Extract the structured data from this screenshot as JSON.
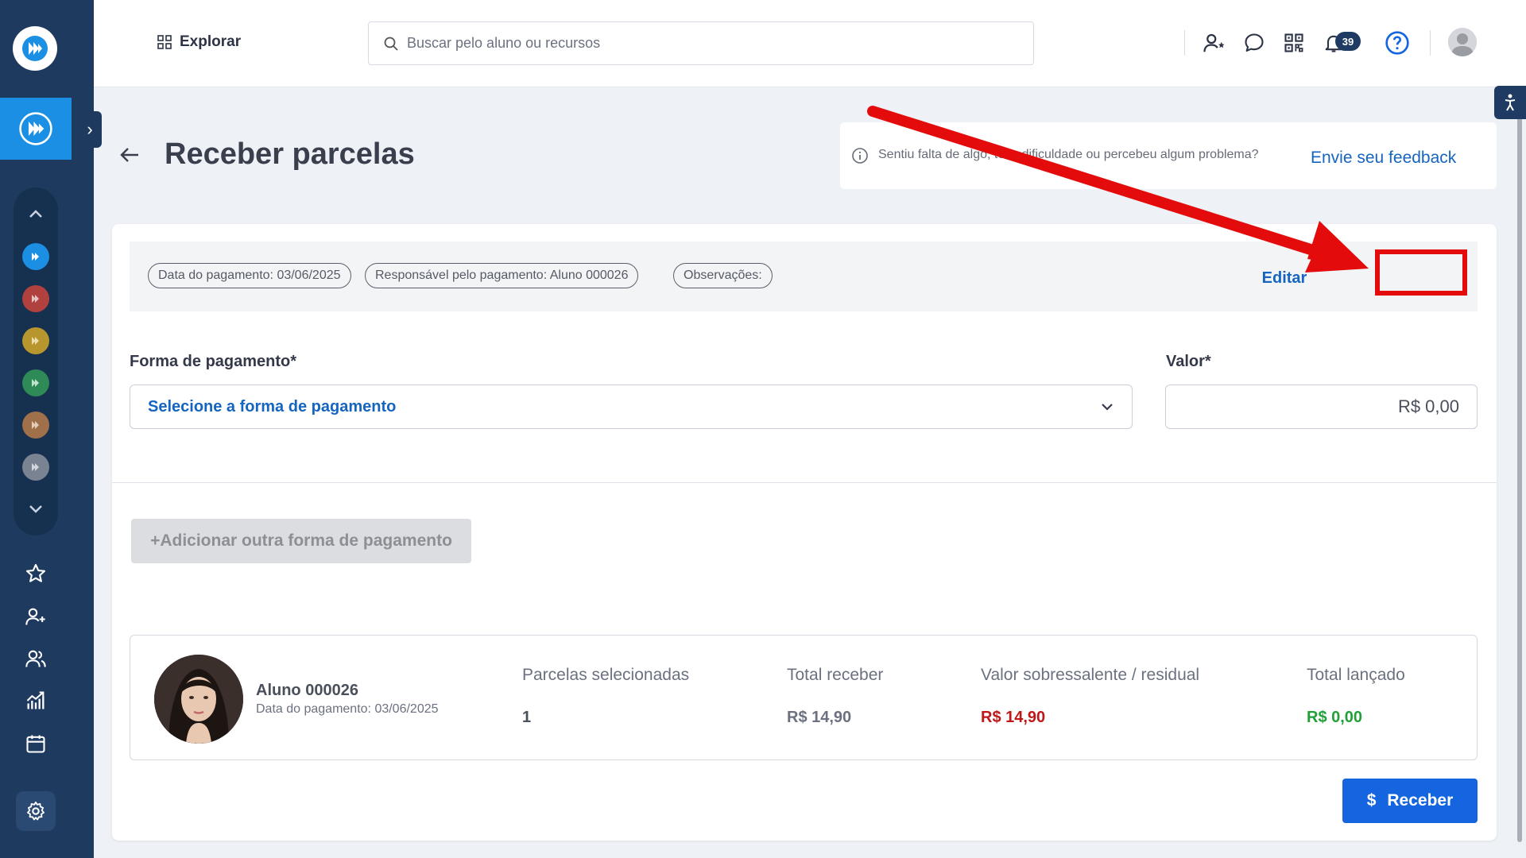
{
  "header": {
    "explore_label": "Explorar",
    "search_placeholder": "Buscar pelo aluno ou recursos",
    "notification_count": "39"
  },
  "page": {
    "title": "Receber parcelas"
  },
  "feedback": {
    "text": "Sentiu falta de algo, teve dificuldade ou percebeu algum problema?",
    "link": "Envie seu feedback"
  },
  "info_strip": {
    "payment_date": "Data do pagamento: 03/06/2025",
    "responsible": "Responsável pelo pagamento: Aluno 000026",
    "notes": "Observações:",
    "edit_label": "Editar"
  },
  "form": {
    "payment_method_label": "Forma de pagamento*",
    "payment_method_placeholder": "Selecione a forma de pagamento",
    "value_label": "Valor*",
    "value": "R$ 0,00",
    "add_method_label": "Adicionar outra forma de pagamento"
  },
  "summary": {
    "student_name": "Aluno 000026",
    "student_date": "Data do pagamento: 03/06/2025",
    "columns": [
      {
        "header": "Parcelas selecionadas",
        "value": "1",
        "color": "#4a4f5c"
      },
      {
        "header": "Total receber",
        "value": "R$ 14,90",
        "color": "#6b7180"
      },
      {
        "header": "Valor sobressalente / residual",
        "value": "R$ 14,90",
        "color": "#c01818"
      },
      {
        "header": "Total lançado",
        "value": "R$ 0,00",
        "color": "#21a038"
      }
    ]
  },
  "actions": {
    "receive_label": "Receber"
  },
  "colors": {
    "sidebar": "#1e3a5f",
    "accent": "#1565c0",
    "highlight": "#e30b0b",
    "module_dots": [
      "#1a8fe3",
      "#b0413e",
      "#b8962e",
      "#2e8b57",
      "#a0704a",
      "#7a8391"
    ]
  }
}
